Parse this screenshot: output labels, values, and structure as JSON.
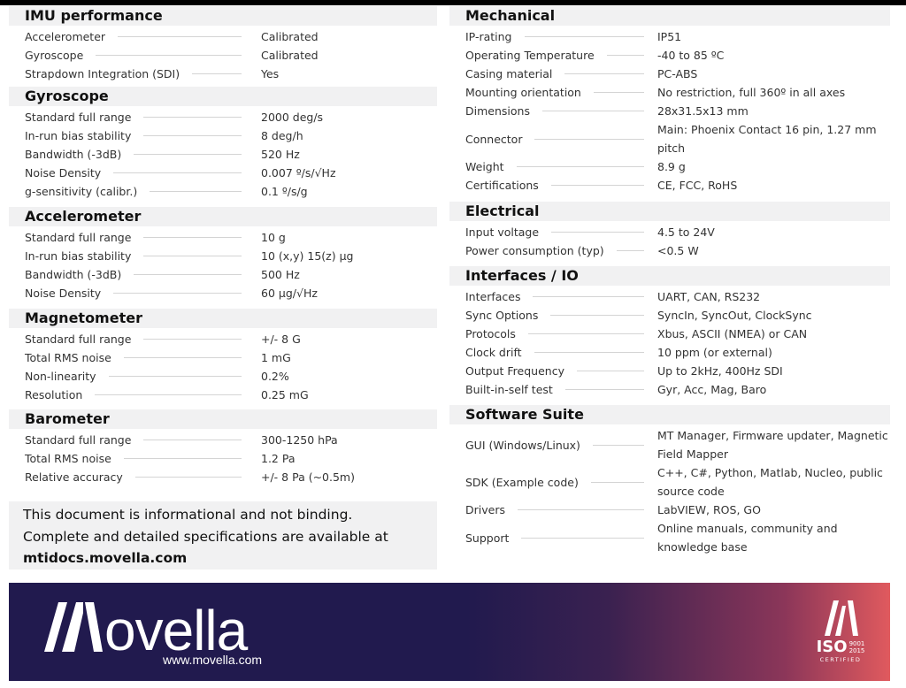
{
  "left_sections": [
    {
      "title": "IMU performance",
      "rows": [
        [
          "Accelerometer",
          "Calibrated"
        ],
        [
          "Gyroscope",
          "Calibrated"
        ],
        [
          "Strapdown Integration (SDI)",
          "Yes"
        ]
      ]
    },
    {
      "title": "Gyroscope",
      "rows": [
        [
          "Standard full range",
          "2000 deg/s"
        ],
        [
          "In-run bias stability",
          "8 deg/h"
        ],
        [
          "Bandwidth (-3dB)",
          "520 Hz"
        ],
        [
          "Noise Density",
          "0.007 º/s/√Hz"
        ],
        [
          "g-sensitivity (calibr.)",
          "0.1 º/s/g"
        ]
      ]
    },
    {
      "title": "Accelerometer",
      "rows": [
        [
          "Standard full range",
          "10 g"
        ],
        [
          "In-run bias stability",
          "10 (x,y) 15(z) µg"
        ],
        [
          "Bandwidth (-3dB)",
          "500 Hz"
        ],
        [
          "Noise Density",
          "60 µg/√Hz"
        ]
      ]
    },
    {
      "title": "Magnetometer",
      "rows": [
        [
          "Standard full range",
          "+/- 8 G"
        ],
        [
          "Total RMS noise",
          "1 mG"
        ],
        [
          "Non-linearity",
          "0.2%"
        ],
        [
          "Resolution",
          "0.25 mG"
        ]
      ]
    },
    {
      "title": "Barometer",
      "rows": [
        [
          "Standard full range",
          "300-1250 hPa"
        ],
        [
          "Total RMS noise",
          "1.2 Pa"
        ],
        [
          "Relative accuracy",
          "+/- 8 Pa (~0.5m)"
        ]
      ]
    }
  ],
  "right_sections": [
    {
      "title": "Mechanical",
      "rows": [
        [
          "IP-rating",
          "IP51"
        ],
        [
          "Operating Temperature",
          "-40 to 85 ºC"
        ],
        [
          "Casing material",
          "PC-ABS"
        ],
        [
          "Mounting orientation",
          "No restriction, full 360º in all axes"
        ],
        [
          "Dimensions",
          "28x31.5x13 mm"
        ],
        [
          "Connector",
          "Main: Phoenix Contact 16 pin, 1.27 mm pitch"
        ],
        [
          "Weight",
          "8.9 g"
        ],
        [
          "Certifications",
          "CE, FCC, RoHS"
        ]
      ]
    },
    {
      "title": "Electrical",
      "rows": [
        [
          "Input voltage",
          "4.5 to 24V"
        ],
        [
          "Power consumption (typ)",
          "<0.5 W"
        ]
      ]
    },
    {
      "title": "Interfaces / IO",
      "rows": [
        [
          "Interfaces",
          "UART, CAN, RS232"
        ],
        [
          "Sync Options",
          "SyncIn, SyncOut, ClockSync"
        ],
        [
          "Protocols",
          "Xbus, ASCII (NMEA) or CAN"
        ],
        [
          "Clock drift",
          "10 ppm (or external)"
        ],
        [
          "Output Frequency",
          "Up to 2kHz, 400Hz SDI"
        ],
        [
          "Built-in-self test",
          "Gyr, Acc, Mag, Baro"
        ]
      ]
    },
    {
      "title": "Software Suite",
      "rows": [
        [
          "GUI (Windows/Linux)",
          "MT Manager, Firmware updater, Magnetic Field Mapper"
        ],
        [
          "SDK (Example code)",
          "C++, C#, Python, Matlab, Nucleo, public source code"
        ],
        [
          "Drivers",
          "LabVIEW, ROS, GO"
        ],
        [
          "Support",
          "Online manuals, community and knowledge base"
        ]
      ]
    }
  ],
  "disclaimer": {
    "line1": "This document is informational and not binding.",
    "line2": "Complete and detailed specifications are available at",
    "link": "mtidocs.movella.com"
  },
  "banner": {
    "logo_text": "Movella",
    "url": "www.movella.com",
    "iso": "ISO",
    "iso_std": "9001",
    "iso_year": "2015",
    "certified": "CERTIFIED"
  },
  "colors": {
    "banner_dark": "#211a4e",
    "banner_accent": "#e05a5e",
    "header_bg": "#f1f1f2"
  }
}
